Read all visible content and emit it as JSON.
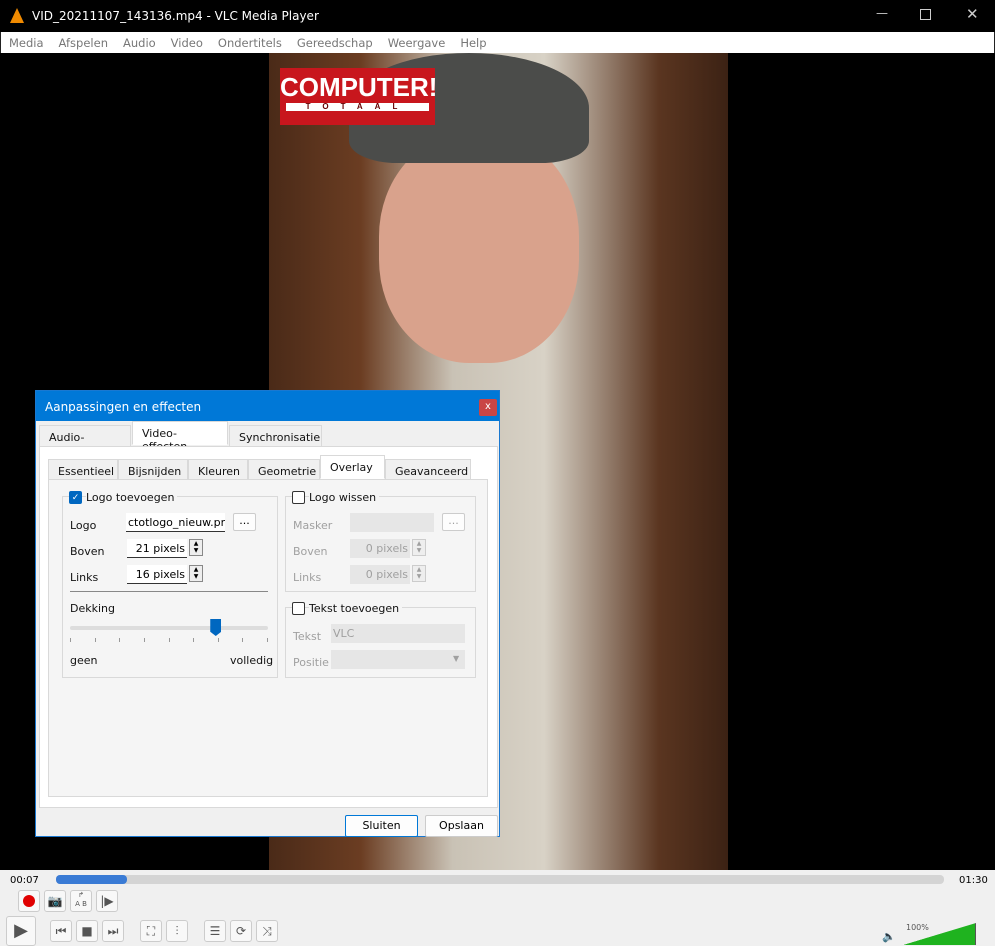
{
  "window": {
    "title": "VID_20211107_143136.mp4 - VLC Media Player"
  },
  "menu": [
    "Media",
    "Afspelen",
    "Audio",
    "Video",
    "Ondertitels",
    "Gereedschap",
    "Weergave",
    "Help"
  ],
  "video": {
    "logo_text": "COMPUTER!",
    "logo_sub": "TOTAAL"
  },
  "player": {
    "elapsed": "00:07",
    "total": "01:30",
    "progress": 0.08,
    "volume_label": "100%",
    "volume": 1.0
  },
  "dialog": {
    "title": "Aanpassingen en effecten",
    "close": "x",
    "tabs": [
      "Audio-effecten",
      "Video-effecten",
      "Synchronisatie"
    ],
    "subtabs": [
      "Essentieel",
      "Bijsnijden",
      "Kleuren",
      "Geometrie",
      "Overlay",
      "Geavanceerd"
    ],
    "logo_group": {
      "label": "Logo toevoegen",
      "checked": true,
      "logo_label": "Logo",
      "logo_value": "ctotlogo_nieuw.png",
      "browse": "...",
      "top_label": "Boven",
      "top_value": "21 pixels",
      "left_label": "Links",
      "left_value": "16 pixels",
      "opacity_label": "Dekking",
      "opacity": 0.75,
      "min_label": "geen",
      "max_label": "volledig"
    },
    "erase_group": {
      "label": "Logo wissen",
      "checked": false,
      "mask_label": "Masker",
      "mask_value": "",
      "browse": "...",
      "top_label": "Boven",
      "top_value": "0 pixels",
      "left_label": "Links",
      "left_value": "0 pixels"
    },
    "text_group": {
      "label": "Tekst toevoegen",
      "checked": false,
      "text_label": "Tekst",
      "text_value": "VLC",
      "position_label": "Positie",
      "position_value": ""
    },
    "close_button": "Sluiten",
    "save_button": "Opslaan"
  },
  "colors": {
    "accent": "#0078d7",
    "progress": "#3a7bd5",
    "record": "#e00000",
    "volume": "#22bb22"
  }
}
